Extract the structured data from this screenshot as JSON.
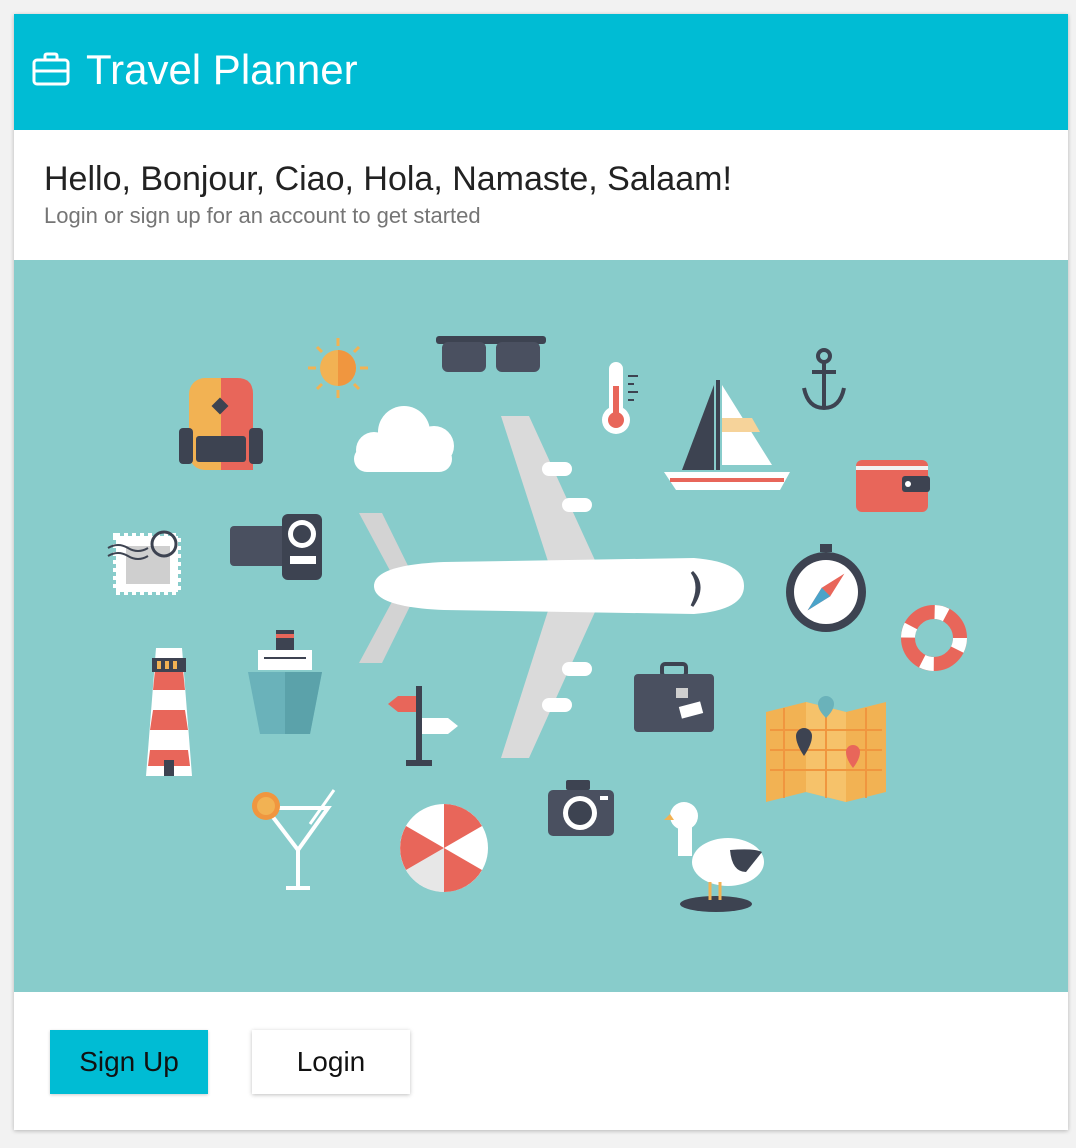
{
  "appbar": {
    "title": "Travel Planner",
    "icon": "briefcase-icon",
    "color": "#00bcd4"
  },
  "welcome": {
    "headline": "Hello, Bonjour, Ciao, Hola, Namaste, Salaam!",
    "subhead": "Login or sign up for an account to get started"
  },
  "hero": {
    "background": "#88cccb",
    "icons": [
      "airplane-icon",
      "backpack-icon",
      "sun-icon",
      "sunglasses-icon",
      "thermometer-icon",
      "sailboat-icon",
      "anchor-icon",
      "wallet-icon",
      "cloud-icon",
      "postage-stamp-icon",
      "video-camera-icon",
      "compass-icon",
      "life-ring-icon",
      "lighthouse-icon",
      "cruise-ship-icon",
      "signpost-icon",
      "suitcase-icon",
      "map-icon",
      "cocktail-icon",
      "camera-icon",
      "beach-ball-icon",
      "seagull-icon"
    ]
  },
  "actions": {
    "signup_label": "Sign Up",
    "login_label": "Login"
  }
}
